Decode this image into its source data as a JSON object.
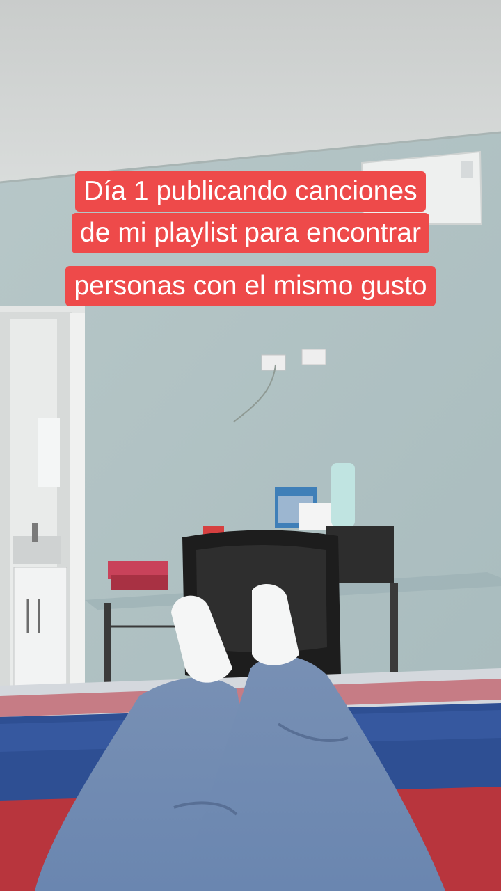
{
  "caption": {
    "line1": "Día 1 publicando canciones",
    "line2": "de mi playlist para encontrar",
    "line3": "personas con el mismo gusto",
    "background_color": "#ee4a4a",
    "text_color": "#ffffff"
  }
}
